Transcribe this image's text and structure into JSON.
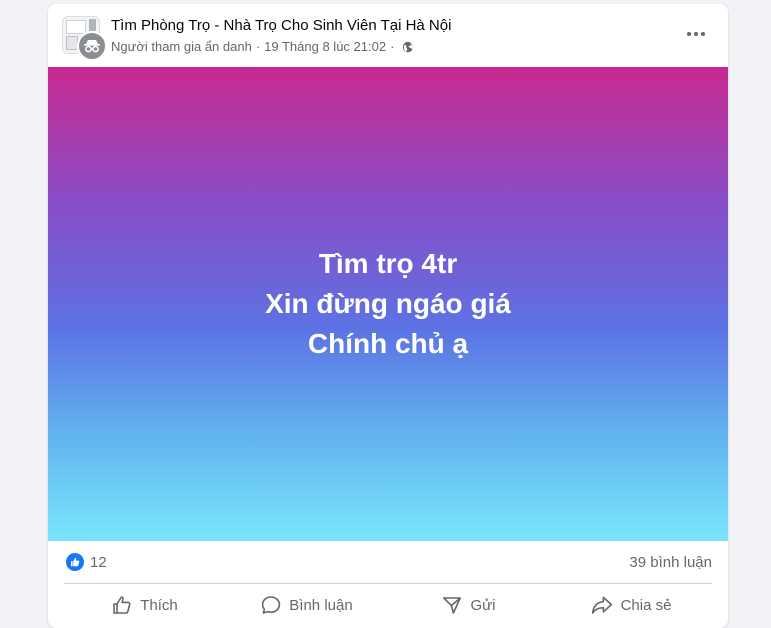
{
  "post": {
    "group_name": "Tìm Phòng Trọ - Nhà Trọ Cho Sinh Viên Tại Hà Nội",
    "author": "Người tham gia ẩn danh",
    "separator": "·",
    "timestamp": "19 Tháng 8 lúc 21:02",
    "background_gradient": [
      "#c72a8f",
      "#8a4cc6",
      "#5c72e3",
      "#62b4f0",
      "#7ae6fb"
    ],
    "lines": [
      "Tìm trọ 4tr",
      "Xin đừng ngáo giá",
      "Chính chủ ạ"
    ]
  },
  "stats": {
    "like_count": "12",
    "comment_count": "39 bình luận"
  },
  "actions": {
    "like": "Thích",
    "comment": "Bình luận",
    "send": "Gửi",
    "share": "Chia sẻ"
  },
  "icons": {
    "more": "more-horizontal-icon",
    "globe": "globe-icon",
    "like_reaction": "thumbs-up-icon",
    "like": "thumbs-up-outline-icon",
    "comment": "comment-bubble-icon",
    "send": "send-icon",
    "share": "share-arrow-icon"
  },
  "colors": {
    "accent": "#1877f2",
    "secondary_text": "#65676b"
  }
}
